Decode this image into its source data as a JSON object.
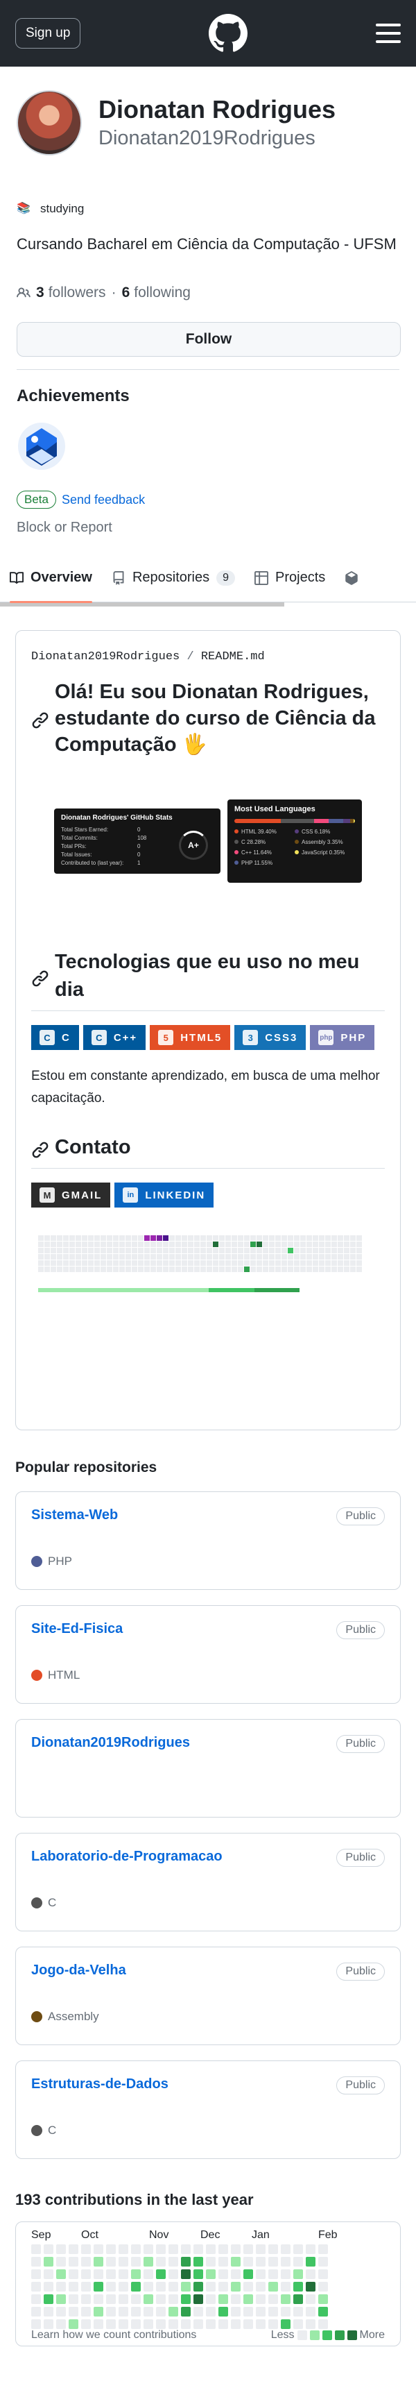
{
  "header": {
    "signup_label": "Sign up"
  },
  "profile": {
    "fullname": "Dionatan Rodrigues",
    "login": "Dionatan2019Rodrigues",
    "status": "studying",
    "bio": "Cursando Bacharel em Ciência da Computação - UFSM",
    "followers_count": "3",
    "followers_label": "followers",
    "following_count": "6",
    "following_label": "following",
    "follow_label": "Follow",
    "achievements_title": "Achievements",
    "beta_label": "Beta",
    "feedback_label": "Send feedback",
    "block_label": "Block or Report"
  },
  "tabs": [
    {
      "label": "Overview"
    },
    {
      "label": "Repositories",
      "count": "9"
    },
    {
      "label": "Projects"
    }
  ],
  "readme": {
    "path_user": "Dionatan2019Rodrigues",
    "path_sep": " / ",
    "path_file": "README.md",
    "heading1": "Olá! Eu sou Dionatan Rodrigues, estudante do curso de Ciência da Computação 🖐",
    "heading2": "Tecnologias que eu uso no meu dia",
    "paragraph": "Estou em constante aprendizado, em busca de uma melhor capacitação.",
    "heading3": "Contato",
    "stats_title": "Dionatan Rodrigues' GitHub Stats",
    "stats_rows": [
      {
        "k": "Total Stars Earned:",
        "v": "0"
      },
      {
        "k": "Total Commits:",
        "v": "108"
      },
      {
        "k": "Total PRs:",
        "v": "0"
      },
      {
        "k": "Total Issues:",
        "v": "0"
      },
      {
        "k": "Contributed to (last year):",
        "v": "1"
      }
    ],
    "stats_grade": "A+",
    "langs_title": "Most Used Languages",
    "langs": [
      {
        "name": "HTML 39.40%",
        "color": "#e34c26"
      },
      {
        "name": "CSS 6.18%",
        "color": "#563d7c"
      },
      {
        "name": "C 28.28%",
        "color": "#555555"
      },
      {
        "name": "Assembly 3.35%",
        "color": "#6e4c13"
      },
      {
        "name": "C++ 11.64%",
        "color": "#f34b7d"
      },
      {
        "name": "JavaScript 0.35%",
        "color": "#f1e05a"
      },
      {
        "name": "PHP 11.55%",
        "color": "#4f5d95"
      }
    ],
    "tech_badges": [
      {
        "label": "C",
        "icon": "C",
        "color": "#00599c"
      },
      {
        "label": "C++",
        "icon": "C",
        "color": "#00599c"
      },
      {
        "label": "HTML5",
        "icon": "5",
        "color": "#e34f26"
      },
      {
        "label": "CSS3",
        "icon": "3",
        "color": "#1572b6"
      },
      {
        "label": "PHP",
        "icon": "php",
        "color": "#777bb4"
      }
    ],
    "contact_badges": [
      {
        "label": "GMAIL",
        "icon": "M",
        "color": "#2b2b2b"
      },
      {
        "label": "LINKEDIN",
        "icon": "in",
        "color": "#0a66c2"
      }
    ]
  },
  "popular": {
    "title": "Popular repositories",
    "repos": [
      {
        "name": "Sistema-Web",
        "visibility": "Public",
        "language": "PHP",
        "lang_color": "#4f5d95"
      },
      {
        "name": "Site-Ed-Fisica",
        "visibility": "Public",
        "language": "HTML",
        "lang_color": "#e34c26"
      },
      {
        "name": "Dionatan2019Rodrigues",
        "visibility": "Public",
        "language": "",
        "lang_color": ""
      },
      {
        "name": "Laboratorio-de-Programacao",
        "visibility": "Public",
        "language": "C",
        "lang_color": "#555555"
      },
      {
        "name": "Jogo-da-Velha",
        "visibility": "Public",
        "language": "Assembly",
        "lang_color": "#6e4c13"
      },
      {
        "name": "Estruturas-de-Dados",
        "visibility": "Public",
        "language": "C",
        "lang_color": "#555555"
      }
    ]
  },
  "contributions": {
    "title": "193 contributions in the last year",
    "months": [
      "Sep",
      "Oct",
      "Nov",
      "Dec",
      "Jan",
      "Feb"
    ],
    "learn_label": "Learn how we count contributions",
    "less_label": "Less",
    "more_label": "More",
    "levels": [
      "#ebedf0",
      "#9be9a8",
      "#40c463",
      "#30a14e",
      "#216e39"
    ]
  }
}
